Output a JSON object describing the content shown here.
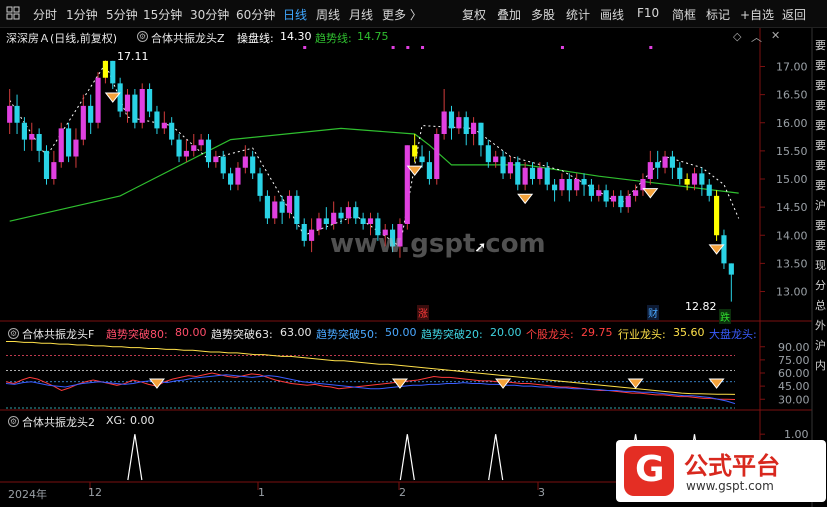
{
  "toolbar": {
    "period_tabs": [
      "分时",
      "1分钟",
      "5分钟",
      "15分钟",
      "30分钟",
      "60分钟",
      "日线",
      "周线",
      "月线",
      "更多 〉"
    ],
    "active_tab": "日线",
    "right_buttons": [
      "复权",
      "叠加",
      "多股",
      "统计",
      "画线",
      "F10",
      "简框",
      "标记",
      "+自选",
      "返回"
    ]
  },
  "main_panel": {
    "stock_title": "深深房Ａ(日线,前复权)",
    "indicator_name": "合体共振龙头Z",
    "line1_label": "操盘线:",
    "line1_value": "14.30",
    "line2_label": "趋势线:",
    "line2_value": "14.75",
    "high_label": "17.11",
    "low_label": "12.82",
    "marker_rise": "涨",
    "marker_finance": "财",
    "marker_fall": "跌",
    "watermark": "www.gspt.com"
  },
  "mid_panel": {
    "indicator_name": "合体共振龙头F",
    "items": [
      {
        "label": "趋势突破80:",
        "value": "80.00",
        "color": "#ff4d6a"
      },
      {
        "label": "趋势突破63:",
        "value": "63.00",
        "color": "#e8e8e8"
      },
      {
        "label": "趋势突破50:",
        "value": "50.00",
        "color": "#4aa8ff"
      },
      {
        "label": "趋势突破20:",
        "value": "20.00",
        "color": "#3fd3e0"
      },
      {
        "label": "个股龙头:",
        "value": "29.75",
        "color": "#ff4040"
      },
      {
        "label": "行业龙头:",
        "value": "35.60",
        "color": "#ffe14a"
      },
      {
        "label": "大盘龙头:",
        "value": "",
        "color": "#3a5cff"
      }
    ]
  },
  "low_panel": {
    "indicator_name": "合体共振龙头2",
    "xg_label": "XG:",
    "xg_value": "0.00"
  },
  "time_axis": {
    "labels": [
      "2024年",
      "12",
      "1",
      "2",
      "3"
    ]
  },
  "right_side_text": [
    "要",
    "要",
    "要",
    "要",
    "要",
    "要",
    "要",
    "要",
    "沪",
    "要",
    "要",
    "现",
    "分",
    "总",
    "外",
    "沪",
    "内"
  ],
  "logo": {
    "name": "公式平台",
    "url": "www.gspt.com"
  },
  "colors": {
    "up": "#e040e0",
    "down": "#2ad3e6",
    "signal_up": "#ffff00",
    "trend_line": "#2fbf2f",
    "dash_line": "#ffffff",
    "accent_orange": "#f3a23b",
    "logo_red": "#e42e24"
  },
  "chart_data": [
    {
      "type": "candlestick",
      "title": "深深房Ａ(日线,前复权)",
      "ylim": [
        12.6,
        17.4
      ],
      "y_ticks": [
        13.0,
        13.5,
        14.0,
        14.5,
        15.0,
        15.5,
        16.0,
        16.5,
        17.0
      ],
      "annotations": {
        "high": 17.11,
        "low": 12.82
      },
      "candles": [
        [
          16.0,
          16.3,
          16.6,
          15.8
        ],
        [
          16.3,
          16.0,
          16.5,
          15.8
        ],
        [
          16.0,
          15.7,
          16.1,
          15.5
        ],
        [
          15.7,
          15.8,
          16.0,
          15.5
        ],
        [
          15.8,
          15.5,
          15.9,
          15.3
        ],
        [
          15.5,
          15.0,
          15.6,
          14.9
        ],
        [
          15.0,
          15.3,
          15.5,
          14.9
        ],
        [
          15.3,
          15.9,
          16.0,
          15.2
        ],
        [
          15.9,
          15.4,
          16.0,
          15.3
        ],
        [
          15.4,
          15.7,
          15.9,
          15.2
        ],
        [
          15.7,
          16.3,
          16.5,
          15.6
        ],
        [
          16.3,
          16.0,
          16.5,
          15.8
        ],
        [
          16.0,
          16.8,
          16.9,
          15.9
        ],
        [
          16.8,
          17.1,
          17.11,
          16.7
        ],
        [
          17.1,
          16.7,
          17.1,
          16.6
        ],
        [
          16.7,
          16.2,
          16.8,
          16.1
        ],
        [
          16.2,
          16.5,
          16.6,
          16.0
        ],
        [
          16.5,
          16.0,
          16.6,
          15.9
        ],
        [
          16.0,
          16.6,
          16.7,
          15.9
        ],
        [
          16.6,
          16.2,
          16.7,
          16.1
        ],
        [
          16.2,
          15.9,
          16.3,
          15.8
        ],
        [
          15.9,
          16.0,
          16.2,
          15.8
        ],
        [
          16.0,
          15.7,
          16.1,
          15.6
        ],
        [
          15.7,
          15.4,
          15.8,
          15.3
        ],
        [
          15.4,
          15.5,
          15.7,
          15.3
        ],
        [
          15.5,
          15.6,
          15.8,
          15.4
        ],
        [
          15.6,
          15.7,
          15.8,
          15.5
        ],
        [
          15.7,
          15.3,
          15.8,
          15.2
        ],
        [
          15.3,
          15.4,
          15.5,
          15.2
        ],
        [
          15.4,
          15.1,
          15.5,
          15.0
        ],
        [
          15.1,
          14.9,
          15.2,
          14.8
        ],
        [
          14.9,
          15.2,
          15.3,
          14.8
        ],
        [
          15.2,
          15.4,
          15.6,
          15.1
        ],
        [
          15.4,
          15.1,
          15.5,
          15.0
        ],
        [
          15.1,
          14.7,
          15.2,
          14.6
        ],
        [
          14.7,
          14.3,
          14.8,
          14.2
        ],
        [
          14.3,
          14.6,
          14.7,
          14.2
        ],
        [
          14.6,
          14.4,
          14.7,
          14.2
        ],
        [
          14.4,
          14.7,
          14.8,
          14.3
        ],
        [
          14.7,
          14.2,
          14.8,
          14.1
        ],
        [
          14.2,
          13.9,
          14.3,
          13.8
        ],
        [
          13.9,
          14.1,
          14.3,
          13.7
        ],
        [
          14.1,
          14.3,
          14.4,
          14.0
        ],
        [
          14.3,
          14.2,
          14.5,
          14.1
        ],
        [
          14.2,
          14.4,
          14.6,
          14.1
        ],
        [
          14.4,
          14.3,
          14.5,
          14.2
        ],
        [
          14.3,
          14.5,
          14.6,
          14.2
        ],
        [
          14.5,
          14.3,
          14.6,
          14.2
        ],
        [
          14.3,
          14.2,
          14.4,
          14.1
        ],
        [
          14.2,
          14.3,
          14.4,
          14.0
        ],
        [
          14.3,
          14.0,
          14.4,
          13.9
        ],
        [
          14.0,
          14.1,
          14.2,
          13.8
        ],
        [
          14.1,
          13.8,
          14.2,
          13.7
        ],
        [
          13.8,
          14.2,
          14.3,
          13.6
        ],
        [
          14.2,
          15.6,
          15.6,
          14.1
        ],
        [
          15.6,
          15.4,
          15.8,
          15.3
        ],
        [
          15.4,
          15.3,
          15.6,
          15.2
        ],
        [
          15.3,
          15.0,
          15.5,
          14.9
        ],
        [
          15.0,
          15.8,
          15.9,
          14.9
        ],
        [
          15.8,
          16.2,
          16.6,
          15.7
        ],
        [
          16.2,
          15.9,
          16.3,
          15.7
        ],
        [
          15.9,
          16.1,
          16.2,
          15.8
        ],
        [
          16.1,
          15.8,
          16.2,
          15.6
        ],
        [
          15.8,
          16.0,
          16.1,
          15.6
        ],
        [
          16.0,
          15.6,
          16.0,
          15.4
        ],
        [
          15.6,
          15.3,
          15.7,
          15.2
        ],
        [
          15.3,
          15.4,
          15.5,
          15.2
        ],
        [
          15.4,
          15.1,
          15.5,
          15.0
        ],
        [
          15.1,
          15.3,
          15.4,
          15.0
        ],
        [
          15.3,
          14.9,
          15.4,
          14.8
        ],
        [
          14.9,
          15.2,
          15.3,
          14.8
        ],
        [
          15.2,
          15.0,
          15.3,
          14.9
        ],
        [
          15.0,
          15.2,
          15.3,
          14.9
        ],
        [
          15.2,
          14.9,
          15.3,
          14.8
        ],
        [
          14.9,
          14.8,
          15.0,
          14.6
        ],
        [
          14.8,
          15.0,
          15.1,
          14.7
        ],
        [
          15.0,
          14.8,
          15.1,
          14.6
        ],
        [
          14.8,
          15.0,
          15.1,
          14.7
        ],
        [
          15.0,
          14.9,
          15.1,
          14.7
        ],
        [
          14.9,
          14.7,
          15.0,
          14.6
        ],
        [
          14.7,
          14.8,
          14.9,
          14.6
        ],
        [
          14.8,
          14.6,
          14.9,
          14.5
        ],
        [
          14.6,
          14.7,
          14.8,
          14.5
        ],
        [
          14.7,
          14.5,
          14.8,
          14.4
        ],
        [
          14.5,
          14.7,
          14.8,
          14.4
        ],
        [
          14.7,
          14.8,
          14.9,
          14.6
        ],
        [
          14.8,
          15.0,
          15.1,
          14.7
        ],
        [
          15.0,
          15.3,
          15.5,
          14.9
        ],
        [
          15.3,
          15.2,
          15.5,
          15.0
        ],
        [
          15.2,
          15.4,
          15.5,
          15.1
        ],
        [
          15.4,
          15.2,
          15.5,
          15.0
        ],
        [
          15.2,
          15.0,
          15.3,
          14.9
        ],
        [
          15.0,
          14.9,
          15.1,
          14.8
        ],
        [
          14.9,
          15.1,
          15.2,
          14.8
        ],
        [
          15.1,
          14.9,
          15.2,
          14.7
        ],
        [
          14.9,
          14.7,
          15.0,
          14.6
        ],
        [
          14.7,
          14.0,
          14.8,
          13.9
        ],
        [
          14.0,
          13.5,
          14.1,
          13.4
        ],
        [
          13.5,
          13.3,
          13.5,
          12.82
        ]
      ],
      "signal_bars": [
        13,
        55,
        92,
        96
      ],
      "diamond_markers": [
        14,
        55,
        70,
        87,
        96
      ],
      "trend_line": [
        [
          0,
          14.25
        ],
        [
          15,
          14.7
        ],
        [
          30,
          15.7
        ],
        [
          45,
          15.9
        ],
        [
          55,
          15.8
        ],
        [
          57,
          15.6
        ],
        [
          60,
          15.25
        ],
        [
          70,
          15.25
        ],
        [
          80,
          15.05
        ],
        [
          99,
          14.75
        ]
      ],
      "operation_line": [
        [
          0,
          16.4
        ],
        [
          5,
          15.4
        ],
        [
          13,
          17.05
        ],
        [
          16,
          16.1
        ],
        [
          22,
          15.95
        ],
        [
          27,
          15.35
        ],
        [
          33,
          15.55
        ],
        [
          40,
          14.0
        ],
        [
          47,
          14.35
        ],
        [
          53,
          13.8
        ],
        [
          56,
          15.95
        ],
        [
          63,
          15.9
        ],
        [
          68,
          15.4
        ],
        [
          75,
          15.15
        ],
        [
          83,
          14.55
        ],
        [
          89,
          15.4
        ],
        [
          94,
          15.2
        ],
        [
          97,
          14.9
        ],
        [
          99,
          14.3
        ]
      ]
    },
    {
      "type": "line",
      "title": "合体共振龙头F",
      "ylim": [
        20,
        100
      ],
      "y_ticks": [
        30,
        45,
        60,
        75,
        90
      ],
      "reference_lines": [
        80,
        63,
        50,
        20
      ],
      "series": [
        {
          "name": "个股龙头",
          "values": [
            50,
            48,
            52,
            55,
            53,
            49,
            45,
            40,
            43,
            47,
            50,
            52,
            50,
            48,
            46,
            48,
            52,
            50,
            47,
            45,
            50,
            53,
            55,
            57,
            56,
            58,
            60,
            58,
            56,
            55,
            57,
            59,
            58,
            55,
            52,
            50,
            48,
            47,
            46,
            47,
            45,
            44,
            42,
            43,
            44,
            45,
            46,
            47,
            48,
            49,
            50,
            51,
            52,
            54,
            56,
            55,
            55,
            54,
            53,
            52,
            51,
            51,
            50,
            50,
            49,
            48,
            48,
            47,
            46,
            45,
            44,
            44,
            43,
            42,
            41,
            40,
            40,
            39,
            38,
            37,
            37,
            36,
            35,
            35,
            34,
            33,
            33,
            32,
            31,
            31,
            30,
            30,
            29.75
          ]
        },
        {
          "name": "行业龙头",
          "values": [
            96,
            96,
            95,
            95,
            94,
            94,
            93,
            93,
            92,
            92,
            91,
            91,
            90,
            90,
            89,
            89,
            88,
            88,
            87,
            87,
            86,
            86,
            85,
            84,
            84,
            83,
            83,
            82,
            81,
            81,
            80,
            79,
            79,
            78,
            77,
            76,
            75,
            74,
            74,
            73,
            72,
            71,
            70,
            70,
            69,
            68,
            67,
            66,
            65,
            64,
            63,
            62,
            61,
            60,
            59,
            58,
            57,
            56,
            55,
            54,
            53,
            52,
            51,
            50,
            49,
            48,
            47,
            46,
            45,
            44,
            43,
            42,
            41,
            40,
            39,
            38,
            37,
            36.5,
            36.2,
            36,
            35.8,
            35.7,
            35.6
          ]
        },
        {
          "name": "大盘龙头",
          "values": [
            48,
            47,
            49,
            50,
            48,
            46,
            45,
            44,
            46,
            48,
            49,
            50,
            49,
            48,
            47,
            48,
            50,
            51,
            50,
            49,
            51,
            52,
            54,
            55,
            56,
            57,
            58,
            57,
            56,
            55,
            56,
            57,
            56,
            54,
            52,
            50,
            49,
            48,
            47,
            46,
            45,
            44,
            43,
            42,
            42,
            43,
            44,
            45,
            46,
            46,
            47,
            47,
            48,
            48,
            49,
            48,
            48,
            47,
            47,
            46,
            46,
            45,
            45,
            44,
            44,
            43,
            43,
            42,
            42,
            41,
            41,
            40,
            40,
            39,
            39,
            38,
            38,
            37,
            36,
            35,
            34,
            34,
            33,
            32,
            30,
            28,
            25
          ]
        }
      ],
      "diamond_markers": [
        20,
        53,
        67,
        85,
        96
      ]
    },
    {
      "type": "line",
      "title": "合体共振龙头2",
      "ylim": [
        0,
        1.2
      ],
      "y_ticks": [
        0.5,
        1.0
      ],
      "series": [
        {
          "name": "XG",
          "spikes": [
            17,
            54,
            66,
            85,
            93
          ]
        }
      ]
    }
  ]
}
